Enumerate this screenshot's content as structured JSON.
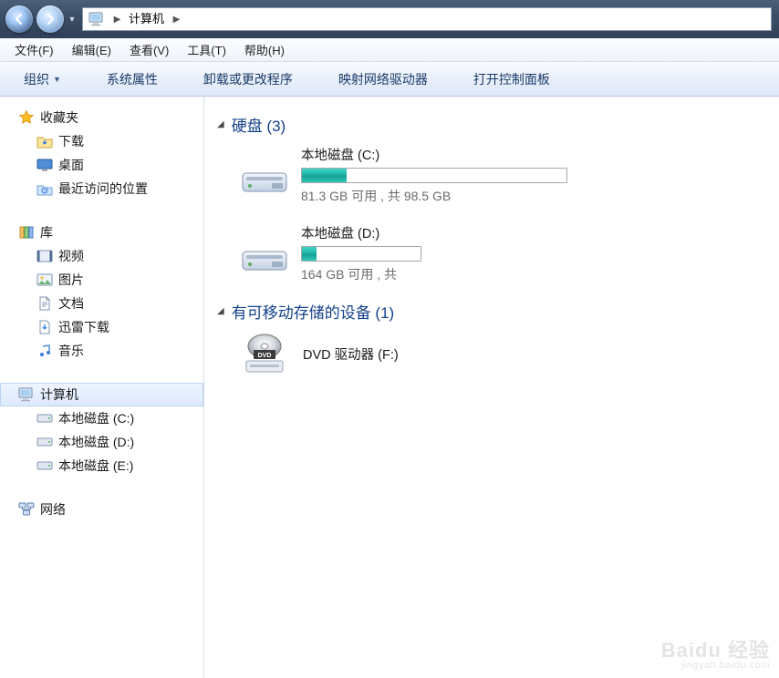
{
  "breadcrumb": {
    "location": "计算机"
  },
  "menu": {
    "file": "文件(F)",
    "edit": "编辑(E)",
    "view": "查看(V)",
    "tools": "工具(T)",
    "help": "帮助(H)"
  },
  "toolbar": {
    "organize": "组织",
    "sysprops": "系统属性",
    "uninstall": "卸载或更改程序",
    "mapdrive": "映射网络驱动器",
    "controlpanel": "打开控制面板"
  },
  "sidebar": {
    "favorites": {
      "label": "收藏夹",
      "downloads": "下载",
      "desktop": "桌面",
      "recent": "最近访问的位置"
    },
    "libraries": {
      "label": "库",
      "videos": "视频",
      "pictures": "图片",
      "docs": "文档",
      "xunlei": "迅雷下载",
      "music": "音乐"
    },
    "computer": {
      "label": "计算机",
      "c": "本地磁盘 (C:)",
      "d": "本地磁盘 (D:)",
      "e": "本地磁盘 (E:)"
    },
    "network": {
      "label": "网络"
    }
  },
  "groups": {
    "hdd": {
      "title": "硬盘 (3)"
    },
    "removable": {
      "title": "有可移动存储的设备 (1)"
    }
  },
  "drives": {
    "c": {
      "name": "本地磁盘 (C:)",
      "info": "81.3 GB 可用 , 共 98.5 GB",
      "fill_pct": 17
    },
    "d": {
      "name": "本地磁盘 (D:)",
      "info": "164 GB 可用 , 共",
      "fill_pct": 12
    }
  },
  "dvd": {
    "name": "DVD 驱动器 (F:)"
  },
  "watermark": {
    "brand": "Baidu 经验",
    "url": "jingyan.baidu.com"
  }
}
